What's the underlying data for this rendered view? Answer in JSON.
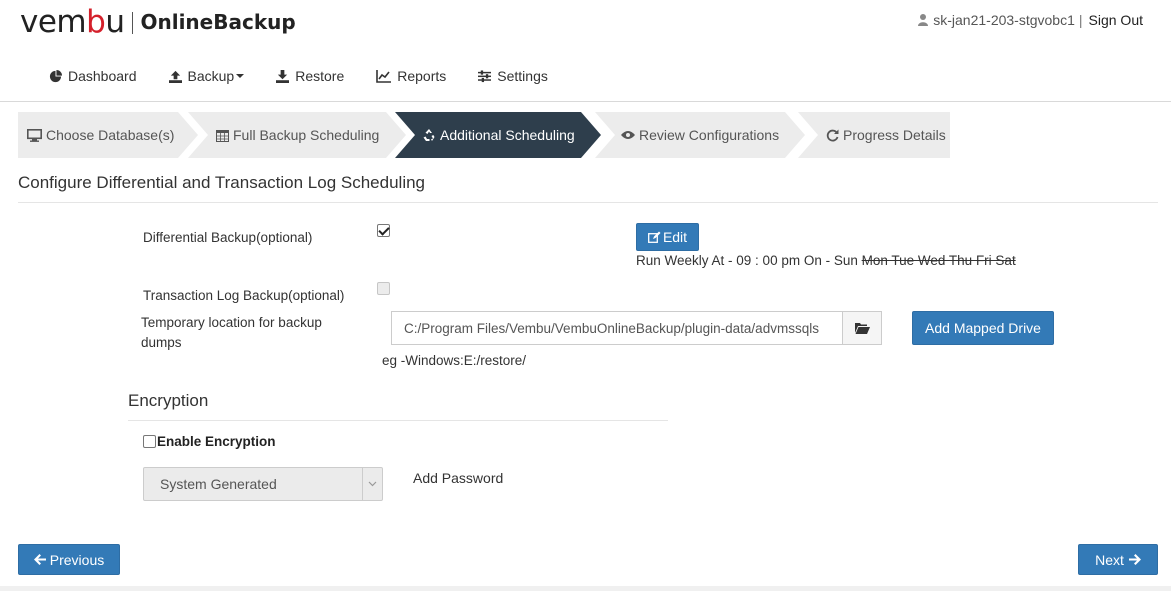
{
  "brand": {
    "logo_prefix": "vem",
    "logo_mid": "b",
    "logo_suffix": "u",
    "product": "OnlineBackup"
  },
  "user": {
    "name": "sk-jan21-203-stgvobc1",
    "divider": "|",
    "signout": "Sign Out"
  },
  "nav": [
    {
      "label": "Dashboard",
      "icon": "pie-chart-icon"
    },
    {
      "label": "Backup",
      "icon": "upload-icon"
    },
    {
      "label": "Restore",
      "icon": "download-icon"
    },
    {
      "label": "Reports",
      "icon": "line-chart-icon"
    },
    {
      "label": "Settings",
      "icon": "sliders-icon"
    }
  ],
  "wizard": [
    {
      "label": "Choose Database(s)",
      "icon": "monitor-icon",
      "active": false
    },
    {
      "label": "Full Backup Scheduling",
      "icon": "calendar-icon",
      "active": false
    },
    {
      "label": "Additional Scheduling",
      "icon": "recycle-icon",
      "active": true
    },
    {
      "label": "Review Configurations",
      "icon": "eye-icon",
      "active": false
    },
    {
      "label": "Progress Details",
      "icon": "refresh-icon",
      "active": false
    }
  ],
  "main": {
    "title": "Configure Differential and Transaction Log Scheduling",
    "differential_label": "Differential Backup(optional)",
    "differential_checked": true,
    "edit_label": "Edit",
    "schedule_prefix": "Run Weekly At - 09 : 00 pm On - Sun",
    "schedule_off_days": "Mon Tue Wed Thu Fri Sat",
    "translog_label": "Transaction Log Backup(optional)",
    "translog_checked": false,
    "temp_label": "Temporary location for backup dumps",
    "temp_path": "C:/Program Files/Vembu/VembuOnlineBackup/plugin-data/advmssqls",
    "add_mapped_drive": "Add Mapped Drive",
    "hint": "eg -Windows:E:/restore/"
  },
  "encryption": {
    "title": "Encryption",
    "enable_label": "Enable Encryption",
    "enabled": false,
    "select_value": "System Generated",
    "add_password": "Add Password"
  },
  "footer": {
    "previous": "Previous",
    "next": "Next"
  },
  "colors": {
    "primary": "#337ab7",
    "active_step": "#2e3e4c",
    "step_bg": "#ececec",
    "brand_red": "#d4202b"
  }
}
